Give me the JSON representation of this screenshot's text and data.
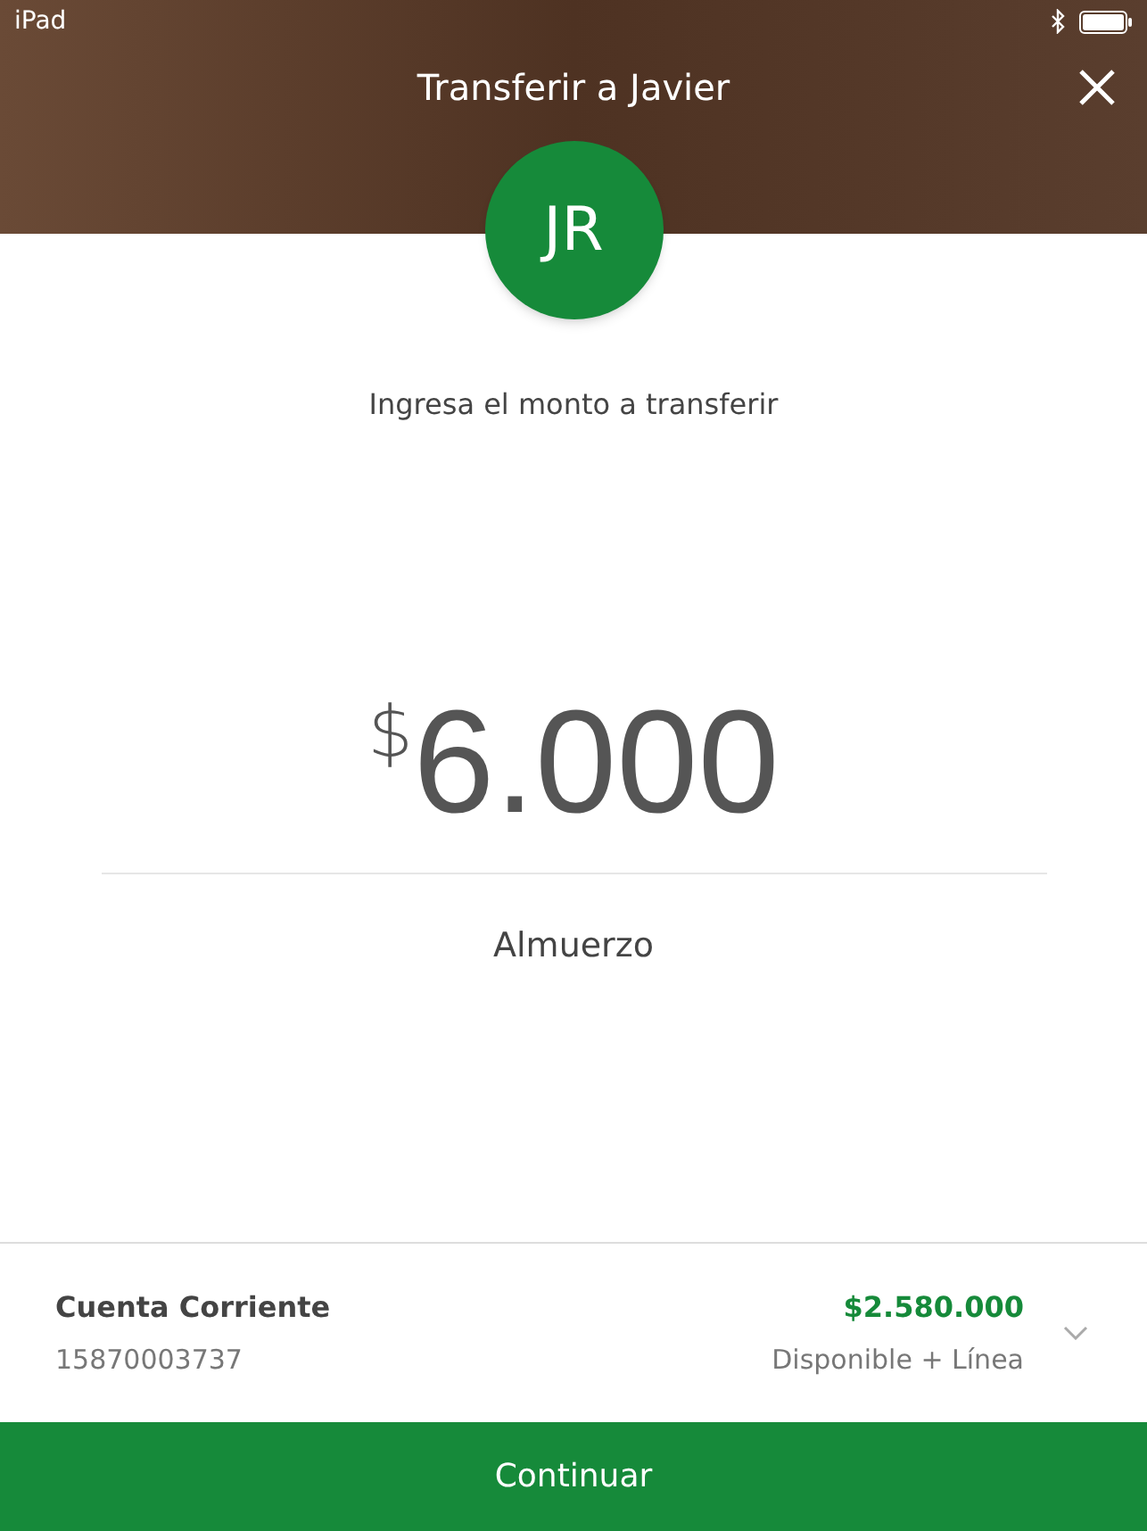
{
  "status_bar": {
    "device": "iPad"
  },
  "header": {
    "title": "Transferir a Javier"
  },
  "avatar": {
    "initials": "JR"
  },
  "prompt": "Ingresa el monto a transferir",
  "amount": {
    "currency": "$",
    "value": "6.000"
  },
  "note": "Almuerzo",
  "account": {
    "name": "Cuenta Corriente",
    "number": "15870003737",
    "balance": "$2.580.000",
    "balance_label": "Disponible + Línea"
  },
  "continue_button": "Continuar"
}
